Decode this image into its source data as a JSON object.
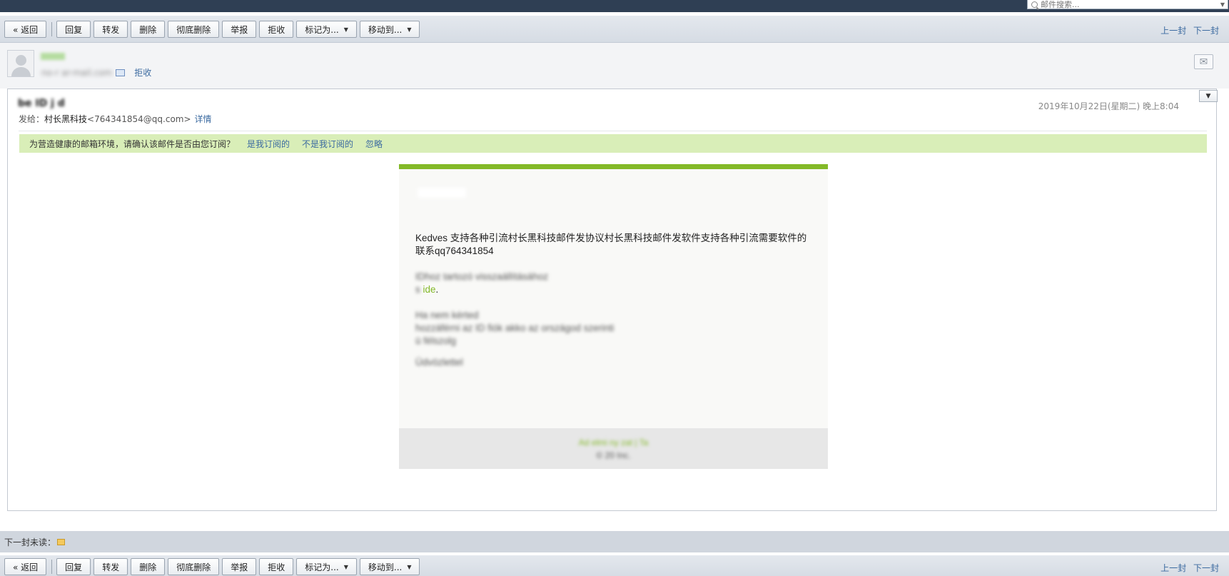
{
  "search": {
    "placeholder": "邮件搜索..."
  },
  "toolbar": {
    "back_label": "« 返回",
    "buttons": [
      "回复",
      "转发",
      "删除",
      "彻底删除",
      "举报",
      "拒收"
    ],
    "mark_label": "标记为...",
    "move_label": "移动到...",
    "prev_label": "上一封",
    "next_label": "下一封"
  },
  "sender": {
    "address": "no-r          ar-mail.com",
    "reject_label": "拒收"
  },
  "mail": {
    "subject": "          be        ID j         d",
    "date": "2019年10月22日(星期二) 晚上8:04",
    "to_prefix": "发给：",
    "to_name": "村长黑科技",
    "to_address": "<764341854@qq.com>",
    "details_label": "详情"
  },
  "notice": {
    "text": "为营造健康的邮箱环境，请确认该邮件是否由您订阅？",
    "yes_label": "是我订阅的",
    "no_label": "不是我订阅的",
    "ignore_label": "忽略"
  },
  "body": {
    "greeting": "Kedves 支持各种引流村长黑科技邮件发协议村长黑科技邮件发软件支持各种引流需要软件的联系qq764341854",
    "p2_text": "                      IDhoz tartozó                        visszaállításához",
    "p2_prefix": "          s",
    "p2_link": "ide",
    "p3_line1": "Ha nem kérted                          ",
    "p3_line2": "hozzáférni az      ID fiók          akko                     az országod szerinti",
    "p3_line3": "ü   félszolg",
    "sign1": "Üdvözlettel",
    "sign2": "             ",
    "footer_links": "             Ad        elmi ny          zat | Ta            ",
    "footer_copy": "© 20            Inc."
  },
  "next_unread": {
    "label": "下一封未读：",
    "subject": "                                                         "
  },
  "colors": {
    "accent": "#83b928",
    "navy": "#2f3f54",
    "link": "#3b6aa0",
    "notice": "#d9eeb8"
  }
}
